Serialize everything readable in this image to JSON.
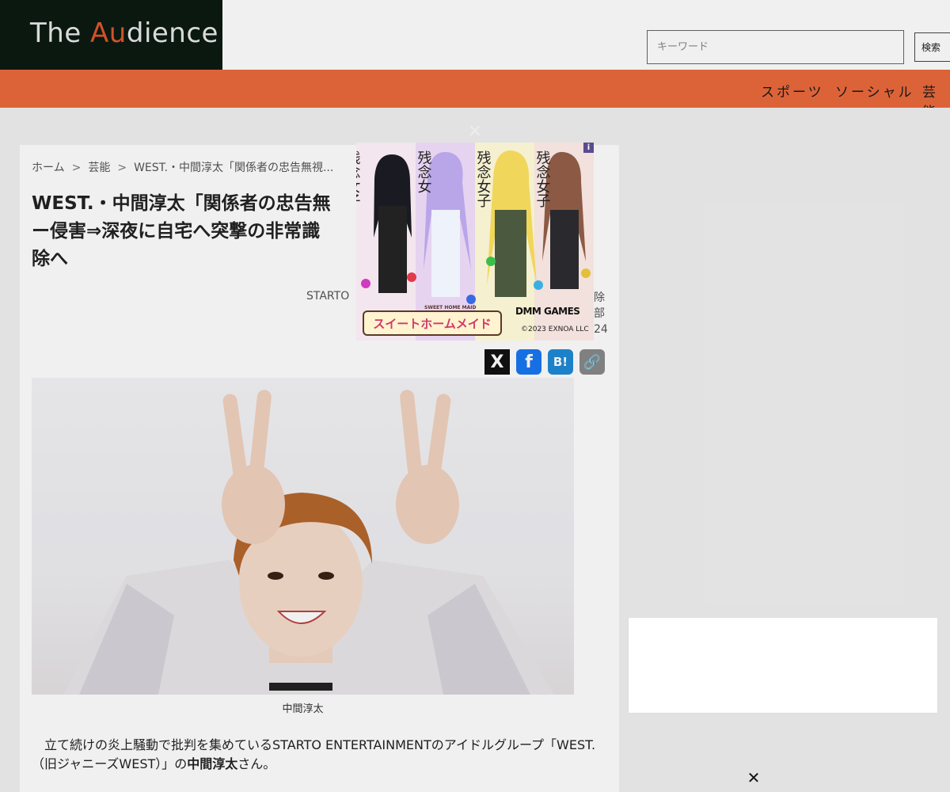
{
  "header": {
    "logo_prefix": "The ",
    "logo_accent": "Au",
    "logo_suffix": "dience",
    "search_placeholder": "キーワード",
    "search_button": "検索"
  },
  "nav": {
    "items": [
      "スポーツ",
      "ソーシャル",
      "芸能"
    ]
  },
  "breadcrumb": {
    "items": [
      "ホーム",
      "芸能",
      "WEST.・中間淳太「関係者の忠告無視..."
    ],
    "separator": ">"
  },
  "article": {
    "title": "WEST.・中間淳太「関係者の忠告無　　　　　　　　　　ー侵害⇒深夜に自宅へ突撃の非常識　　　　　　　　　除へ",
    "title_line1": "WEST.・中間淳太「関係者の忠告無",
    "title_line2": "ー侵害⇒深夜に自宅へ突撃の非常識",
    "title_line3": "除へ",
    "byline_left": "STARTO",
    "byline_right": [
      "除",
      "部",
      "24"
    ],
    "photo_caption": "中間淳太",
    "paragraph_before": "　立て続けの炎上騒動で批判を集めているSTARTO ENTERTAINMENTのアイドルグループ「WEST.（旧ジャニーズWEST）」の",
    "paragraph_bold": "中間淳太",
    "paragraph_after": "さん。"
  },
  "share": {
    "x_icon": "X",
    "facebook_icon": "f",
    "hatena_icon": "B!",
    "link_icon": "🔗"
  },
  "popup_ad": {
    "close_glyph": "×",
    "info_glyph": "i",
    "brand": "DMM GAMES",
    "copyright": "©2023 EXNOA LLC",
    "game_logo": "スイートホームメイド",
    "game_logo_sub": "SWEET HOME MAID",
    "character_text": "残念女子育成ゲーム"
  },
  "floating_ad": {
    "close_glyph": "✕"
  },
  "colors": {
    "logo_bg": "#0b1a12",
    "logo_accent": "#e0572c",
    "nav_bg": "#ea6a3c"
  }
}
